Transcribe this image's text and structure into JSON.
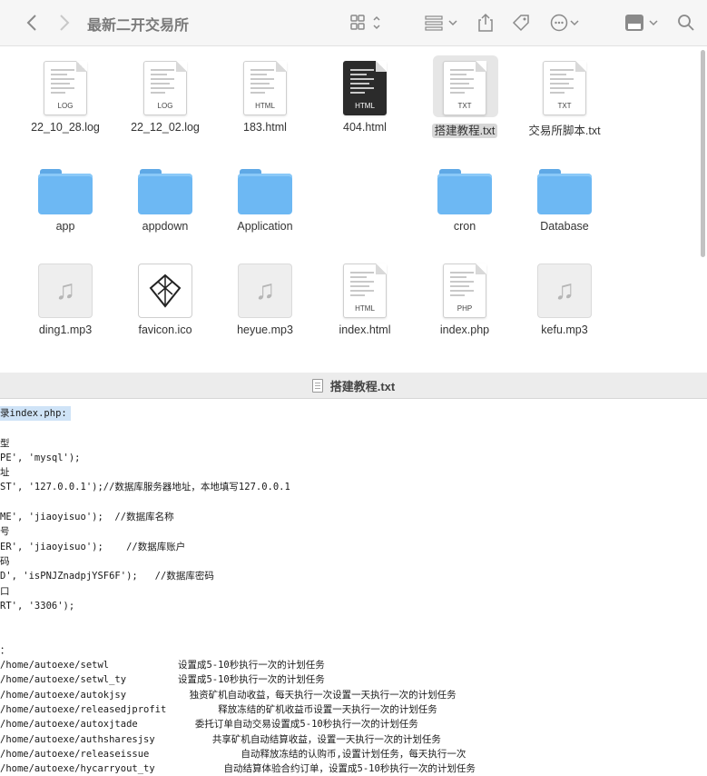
{
  "finder": {
    "title": "最新二开交易所",
    "toolbar_icons": [
      "back-icon",
      "forward-icon",
      "view-grid-icon",
      "group-icon",
      "share-icon",
      "tag-icon",
      "more-icon",
      "app-icon",
      "search-icon"
    ],
    "items": [
      {
        "name": "22_10_28.log",
        "kind": "doc",
        "ext": "LOG"
      },
      {
        "name": "22_12_02.log",
        "kind": "doc",
        "ext": "LOG"
      },
      {
        "name": "183.html",
        "kind": "doc",
        "ext": "HTML"
      },
      {
        "name": "404.html",
        "kind": "dark-doc",
        "ext": "HTML"
      },
      {
        "name": "搭建教程.txt",
        "kind": "doc",
        "ext": "TXT",
        "selected": true
      },
      {
        "name": "交易所脚本.txt",
        "kind": "doc",
        "ext": "TXT"
      },
      {
        "name": "app",
        "kind": "folder"
      },
      {
        "name": "appdown",
        "kind": "folder"
      },
      {
        "name": "Application",
        "kind": "folder"
      },
      {
        "name": "cron",
        "kind": "folder"
      },
      {
        "name": "Database",
        "kind": "folder"
      },
      {
        "name": "ding1.mp3",
        "kind": "audio"
      },
      {
        "name": "favicon.ico",
        "kind": "favicon"
      },
      {
        "name": "heyue.mp3",
        "kind": "audio"
      },
      {
        "name": "index.html",
        "kind": "doc",
        "ext": "HTML"
      },
      {
        "name": "index.php",
        "kind": "doc",
        "ext": "PHP"
      },
      {
        "name": "kefu.mp3",
        "kind": "audio"
      }
    ]
  },
  "editor": {
    "title": "搭建教程.txt",
    "lines": [
      "录index.php:",
      "",
      "型",
      "PE', 'mysql');",
      "址",
      "ST', '127.0.0.1');//数据库服务器地址，本地填写127.0.0.1",
      "",
      "ME', 'jiaoyisuo');  //数据库名称",
      "号",
      "ER', 'jiaoyisuo');    //数据库账户",
      "码",
      "D', 'isPNJZnadpjYSF6F');   //数据库密码",
      "口",
      "RT', '3306');",
      "",
      "",
      "：",
      "/home/autoexe/setwl            设置成5-10秒执行一次的计划任务",
      "/home/autoexe/setwl_ty         设置成5-10秒执行一次的计划任务",
      "/home/autoexe/autokjsy           独资矿机自动收益，每天执行一次设置一天执行一次的计划任务",
      "/home/autoexe/releasedjprofit         释放冻结的矿机收益币设置一天执行一次的计划任务",
      "/home/autoexe/autoxjtade          委托订单自动交易设置成5-10秒执行一次的计划任务",
      "/home/autoexe/authsharesjsy          共享矿机自动结算收益，设置一天执行一次的计划任务",
      "/home/autoexe/releaseissue                自动释放冻结的认购币,设置计划任务，每天执行一次",
      "/home/autoexe/hycarryout_ty            自动结算体验合约订单，设置成5-10秒执行一次的计划任务"
    ]
  }
}
